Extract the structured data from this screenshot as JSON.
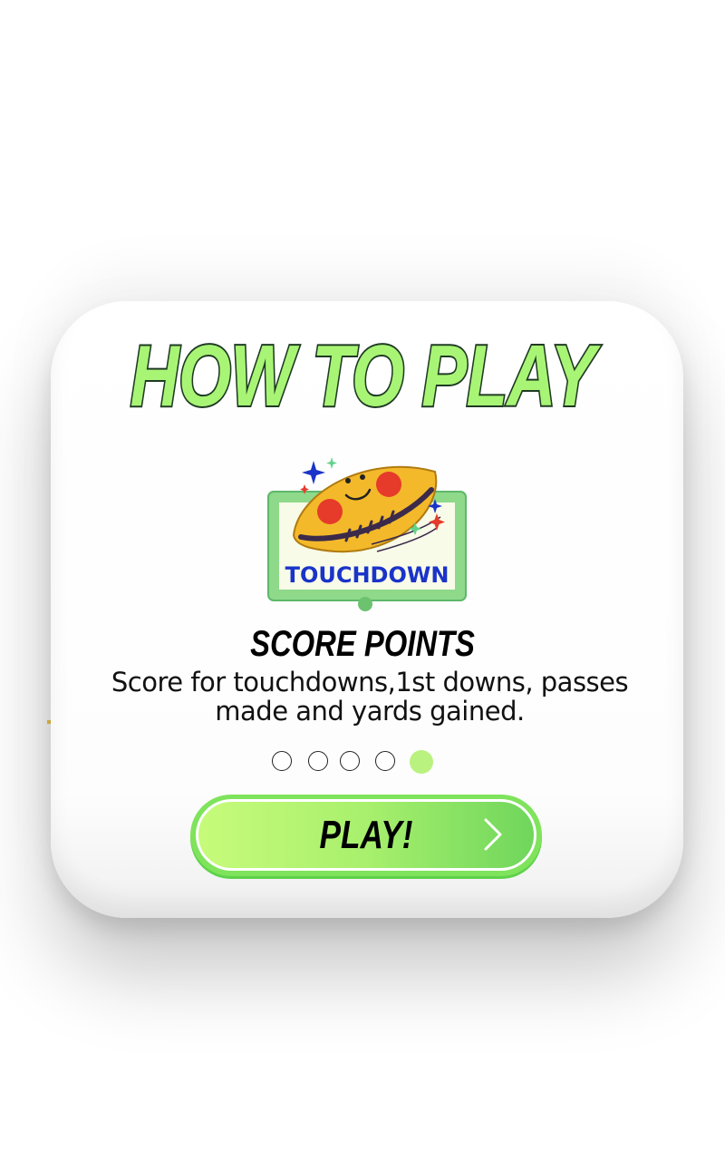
{
  "dialog": {
    "title": "HOW TO PLAY",
    "illustration_sign_text": "TOUCHDOWN",
    "step_heading": "SCORE POINTS",
    "step_description": "Score for touchdowns,1st downs, passes made and yards gained."
  },
  "pagination": {
    "total": 5,
    "current": 5,
    "dots": [
      "empty",
      "empty",
      "empty",
      "empty",
      "active"
    ]
  },
  "play_button": {
    "label": "PLAY!",
    "icon": "chevron-right-icon"
  },
  "colors": {
    "title_fill": "#a8f575",
    "title_stroke": "#1f3a23",
    "button_green": "#7fe35c",
    "active_dot": "#b9f27f",
    "touchdown_text": "#1a33c9",
    "football": "#f3b92a"
  }
}
